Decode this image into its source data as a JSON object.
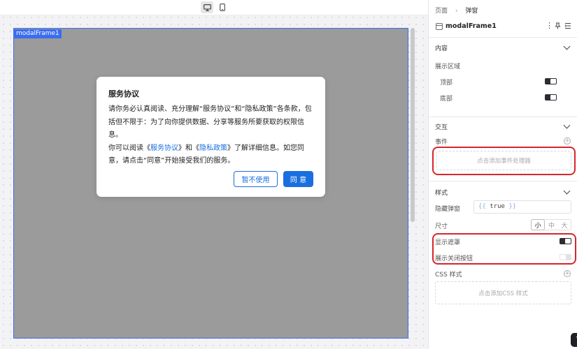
{
  "canvas": {
    "frame_label": "modalFrame1"
  },
  "modal": {
    "title": "服务协议",
    "line1": "请你务必认真阅读、充分理解“服务协议”和“隐私政策”各条款，包",
    "line2": "括但不限于：为了向你提供数据、分享等服务所要获取的权限信",
    "line3": "息。",
    "line4_pre": "你可以阅读《",
    "line4_link1": "服务协议",
    "line4_mid": "》和《",
    "line4_link2": "隐私政策",
    "line4_post": "》了解详细信息。如您同",
    "line5": "意，请点击“同意”开始接受我们的服务。",
    "decline_label": "暂不使用",
    "agree_label": "同 意"
  },
  "panel": {
    "breadcrumb_page": "页面",
    "breadcrumb_current": "弹窗",
    "component_name": "modalFrame1",
    "content": {
      "title": "内容",
      "display_area": "展示区域",
      "top_label": "顶部",
      "bottom_label": "底部"
    },
    "interaction": {
      "title": "交互",
      "events_label": "事件",
      "add_event": "点击添加事件处理器"
    },
    "style": {
      "title": "样式",
      "hide_modal_label": "隐藏弹窗",
      "hide_modal_value": "true",
      "size_label": "尺寸",
      "size_options": [
        "小",
        "中",
        "大"
      ],
      "size_selected": "小",
      "show_mask_label": "显示遮罩",
      "show_close_label": "展示关闭按钮",
      "css_label": "CSS 样式",
      "add_css": "点击添加CSS 样式"
    }
  },
  "colors": {
    "accent": "#1a6fe0",
    "frame_border": "#3a6df0",
    "highlight": "#d7262b"
  },
  "toggles": {
    "top": true,
    "bottom": true,
    "show_mask": true,
    "show_close": false
  }
}
